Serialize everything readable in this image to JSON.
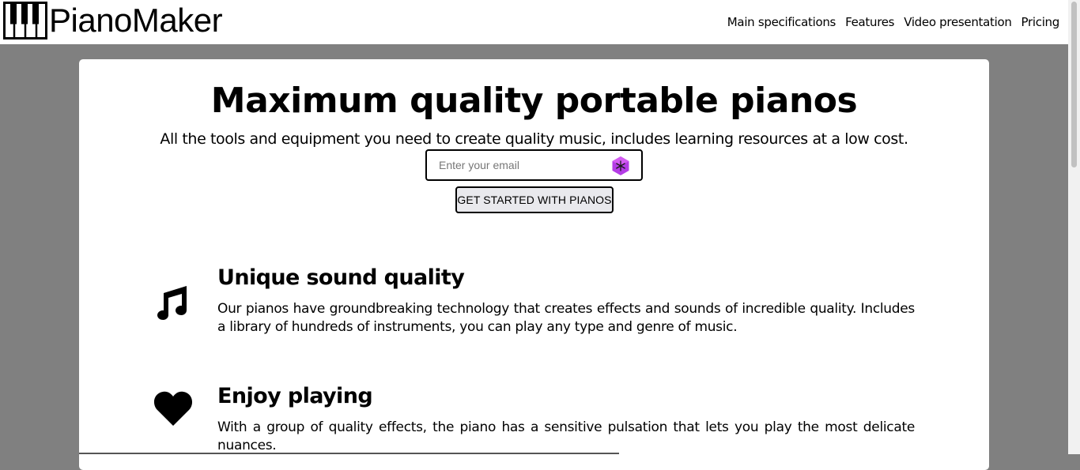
{
  "brand": {
    "name": "PianoMaker",
    "icon": "piano-keys-icon"
  },
  "nav": {
    "items": [
      {
        "label": "Main specifications"
      },
      {
        "label": "Features"
      },
      {
        "label": "Video presentation"
      },
      {
        "label": "Pricing"
      }
    ]
  },
  "hero": {
    "title": "Maximum quality portable pianos",
    "subtitle": "All the tools and equipment you need to create quality music, includes learning resources at a low cost.",
    "email_placeholder": "Enter your email",
    "cta_label": "GET STARTED WITH PIANOS"
  },
  "features": [
    {
      "icon": "music-note-icon",
      "title": "Unique sound quality",
      "text": "Our pianos have groundbreaking technology that creates effects and sounds of incredible quality. Includes a library of hundreds of instruments, you can play any type and genre of music."
    },
    {
      "icon": "heart-icon",
      "title": "Enjoy playing",
      "text": "With a group of quality effects, the piano has a sensitive pulsation that lets you play the most delicate nuances."
    }
  ],
  "colors": {
    "page_bg": "#808080",
    "card_bg": "#ffffff",
    "ext_icon": "#b43ce6"
  }
}
